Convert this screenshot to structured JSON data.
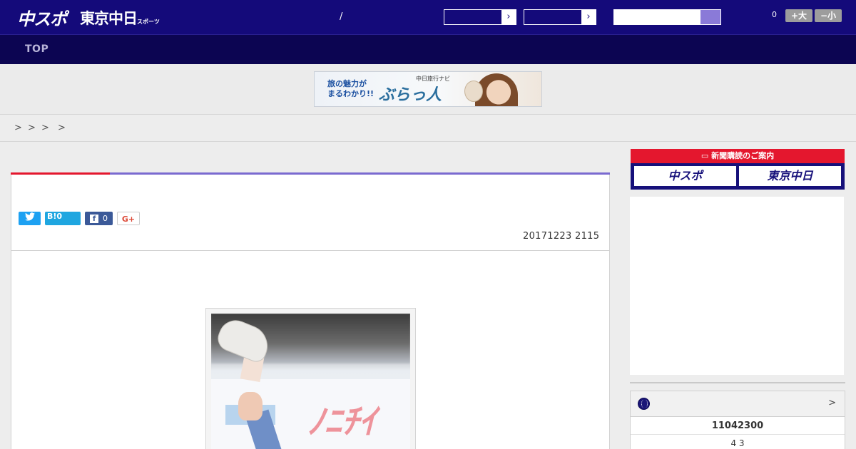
{
  "header": {
    "logo_chuspo": "中スポ",
    "logo_tokyo": "東京中日",
    "logo_tokyo_sub": "スポーツ",
    "slash": "/",
    "select_arrow": "›",
    "search_placeholder": "",
    "font_count": "0",
    "font_plus": "+大",
    "font_minus": "−小"
  },
  "nav": {
    "top": "TOP"
  },
  "banner": {
    "line1": "旅の魅力が",
    "line2": "まるわかり!!",
    "small": "中日旅行ナビ",
    "brand": "ぶらっ人"
  },
  "breadcrumb": [
    ">",
    ">",
    ">",
    ">"
  ],
  "article": {
    "share": {
      "twitter": "t",
      "hatena": "B!0",
      "facebook_icon": "f",
      "facebook_count": "0",
      "gplus": "G+"
    },
    "date": "20171223 2115"
  },
  "sidebar": {
    "subscription_title": "新聞購読のご案内",
    "subscription_chuspo": "中スポ",
    "subscription_tokyo": "東京中日",
    "widget_more": ">",
    "widget_row1": "11042300",
    "widget_row2": "4  3"
  },
  "colors": {
    "header_bg": "#140a7a",
    "nav_bg": "#0c0552",
    "accent_red": "#e4172e",
    "accent_purple": "#7a6ad0"
  }
}
